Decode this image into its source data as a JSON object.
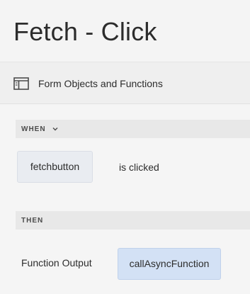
{
  "header": {
    "title": "Fetch - Click"
  },
  "toolbar": {
    "panel_icon": "panel-toggle-icon",
    "label": "Form Objects and Functions"
  },
  "rule": {
    "when": {
      "section_label": "WHEN",
      "collapse_icon": "chevron-down-icon",
      "object": "fetchbutton",
      "condition": "is clicked"
    },
    "then": {
      "section_label": "THEN",
      "action_label": "Function Output",
      "function": "callAsyncFunction"
    }
  },
  "colors": {
    "object_chip_bg": "#e9ecf1",
    "function_chip_bg": "#d3e1f5",
    "section_bar_bg": "#e8e8e8"
  }
}
